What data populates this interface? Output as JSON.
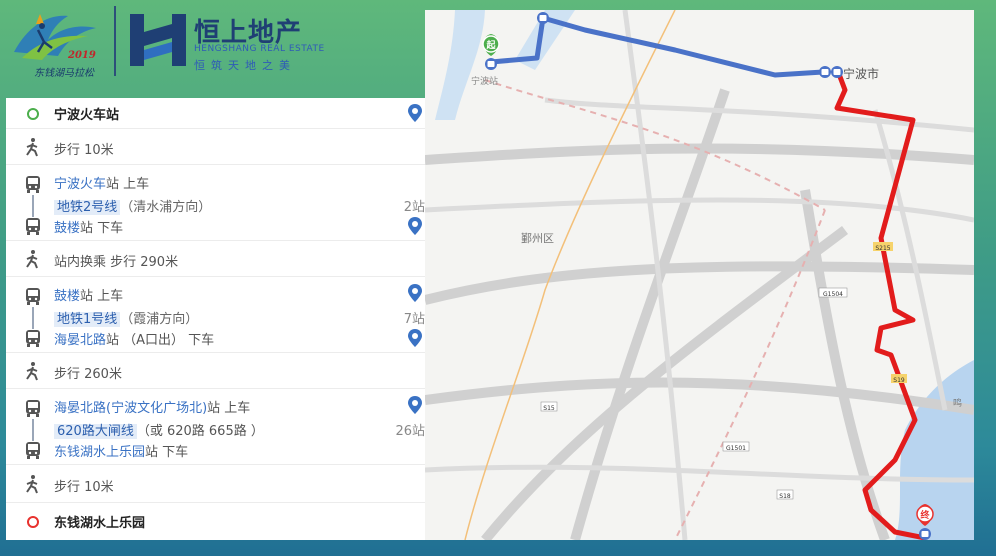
{
  "header": {
    "expo_year": "2019",
    "expo_caption": "东钱湖马拉松",
    "company_name": "恒上地产",
    "company_en": "HENGSHANG REAL ESTATE",
    "company_slogan": "恒筑天地之美"
  },
  "route": {
    "start": {
      "label": "宁波火车站"
    },
    "walk1": {
      "text": "步行 10米"
    },
    "leg1": {
      "board_station": "宁波火车",
      "board_suffix": "站 上车",
      "line": "地铁2号线",
      "direction": "（清水浦方向）",
      "stops": "2站",
      "alight_station": "鼓楼",
      "alight_suffix": "站 下车"
    },
    "transfer": {
      "text": "站内换乘 步行 290米"
    },
    "leg2": {
      "board_station": "鼓楼",
      "board_suffix": "站 上车",
      "line": "地铁1号线",
      "direction": "（霞浦方向）",
      "stops": "7站",
      "alight_station": "海晏北路",
      "alight_suffix": "站 （A口出） 下车"
    },
    "walk2": {
      "text": "步行 260米"
    },
    "leg3": {
      "board_station": "海晏北路(宁波文化广场北)",
      "board_suffix": "站 上车",
      "line": "620路大闸线",
      "alt": "（或 620路 665路 ）",
      "stops": "26站",
      "alight_station": "东钱湖水上乐园",
      "alight_suffix": "站 下车"
    },
    "walk3": {
      "text": "步行 10米"
    },
    "end": {
      "label": "东钱湖水上乐园"
    }
  },
  "map": {
    "start_marker": "起",
    "end_marker": "终",
    "label_station": "宁波站",
    "label_city": "宁波市",
    "label_district": "鄞州区",
    "label_right": "鸣",
    "road_s215": "S215",
    "road_g1504": "G1504",
    "road_s19": "S19",
    "road_s15": "S15",
    "road_g1501": "G1501",
    "road_s18": "S18"
  },
  "colors": {
    "metro_line": "#4a72c8",
    "bus_line": "#e21c1c",
    "start_green": "#4cae4c",
    "end_red": "#e8322e"
  }
}
